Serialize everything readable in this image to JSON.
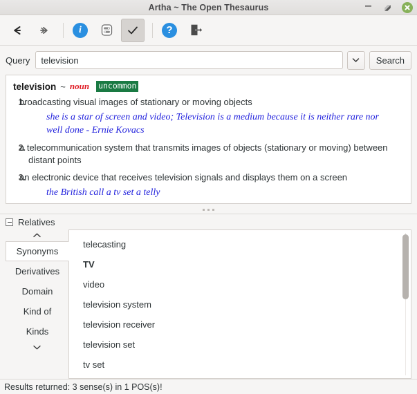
{
  "window": {
    "title": "Artha ~ The Open Thesaurus",
    "minimize_label": "–",
    "maximize_label": "maximize",
    "close_label": "×"
  },
  "toolbar": {
    "back_label": "←",
    "forward_label": "⇥",
    "info_label": "i",
    "notify_label": "notifications",
    "check_label": "✓",
    "help_label": "?",
    "quit_label": "quit"
  },
  "query": {
    "label": "Query",
    "value": "television",
    "placeholder": "",
    "dropdown_label": "⌄",
    "search_label": "Search"
  },
  "definition": {
    "word": "television",
    "separator": "~",
    "pos": "noun",
    "tag": "uncommon",
    "senses": [
      {
        "num": "1.",
        "text": "broadcasting visual images of stationary or moving objects",
        "example": "she is a star of screen and video; Television is a medium because it is neither rare nor well done - Ernie Kovacs"
      },
      {
        "num": "2.",
        "text": "a telecommunication system that transmits images of objects (stationary or moving) between distant points",
        "example": ""
      },
      {
        "num": "3.",
        "text": "an electronic device that receives television signals and displays them on a screen",
        "example": "the British call a tv set a telly"
      }
    ]
  },
  "relatives": {
    "title": "Relatives",
    "scroll_up_label": "⌃",
    "scroll_down_label": "⌄",
    "tabs": [
      {
        "label": "Synonyms",
        "selected": true
      },
      {
        "label": "Derivatives",
        "selected": false
      },
      {
        "label": "Domain",
        "selected": false
      },
      {
        "label": "Kind of",
        "selected": false
      },
      {
        "label": "Kinds",
        "selected": false
      }
    ],
    "items": [
      {
        "label": "telecasting",
        "bold": false
      },
      {
        "label": "TV",
        "bold": true
      },
      {
        "label": "video",
        "bold": false
      },
      {
        "label": "television system",
        "bold": false
      },
      {
        "label": "television receiver",
        "bold": false
      },
      {
        "label": "television set",
        "bold": false
      },
      {
        "label": "tv set",
        "bold": false
      }
    ]
  },
  "status": {
    "text": "Results returned: 3 sense(s) in 1 POS(s)!"
  },
  "colors": {
    "accent_blue": "#2a8fe0",
    "tag_green": "#1a7a43",
    "pos_red": "#e01b24",
    "example_blue": "#2323dd",
    "close_green": "#87b159"
  }
}
